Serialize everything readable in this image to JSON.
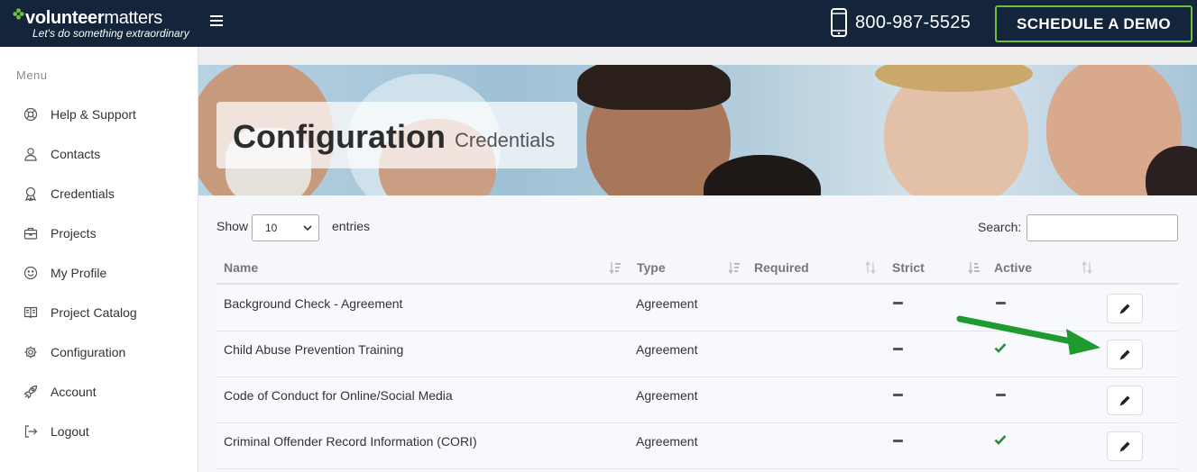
{
  "header": {
    "logo_bold": "volunteer",
    "logo_light": "matters",
    "logo_tagline": "Let's do something extraordinary",
    "phone": "800-987-5525",
    "demo_button": "SCHEDULE A DEMO"
  },
  "sidebar": {
    "title": "Menu",
    "items": [
      {
        "label": "Help & Support",
        "icon": "lifebuoy-icon"
      },
      {
        "label": "Contacts",
        "icon": "user-icon"
      },
      {
        "label": "Credentials",
        "icon": "award-icon"
      },
      {
        "label": "Projects",
        "icon": "briefcase-icon"
      },
      {
        "label": "My Profile",
        "icon": "smile-icon"
      },
      {
        "label": "Project Catalog",
        "icon": "book-icon"
      },
      {
        "label": "Configuration",
        "icon": "gear-icon"
      },
      {
        "label": "Account",
        "icon": "rocket-icon"
      },
      {
        "label": "Logout",
        "icon": "logout-icon"
      }
    ]
  },
  "page": {
    "title": "Configuration",
    "subtitle": "Credentials"
  },
  "table_controls": {
    "show_label": "Show",
    "page_size": "10",
    "entries_label": "entries",
    "search_label": "Search:",
    "search_value": ""
  },
  "table": {
    "columns": [
      "Name",
      "Type",
      "Required",
      "Strict",
      "Active"
    ],
    "rows": [
      {
        "name": "Background Check - Agreement",
        "type": "Agreement",
        "required": "",
        "strict": "dash",
        "active": "dash"
      },
      {
        "name": "Child Abuse Prevention Training",
        "type": "Agreement",
        "required": "",
        "strict": "dash",
        "active": "check"
      },
      {
        "name": "Code of Conduct for Online/Social Media",
        "type": "Agreement",
        "required": "",
        "strict": "dash",
        "active": "dash"
      },
      {
        "name": "Criminal Offender Record Information (CORI)",
        "type": "Agreement",
        "required": "",
        "strict": "dash",
        "active": "check"
      }
    ]
  },
  "colors": {
    "header_bg": "#13243b",
    "accent_green": "#6fbf3a",
    "check_green": "#2e8b3a",
    "annotation_arrow": "#1f9a2e"
  }
}
